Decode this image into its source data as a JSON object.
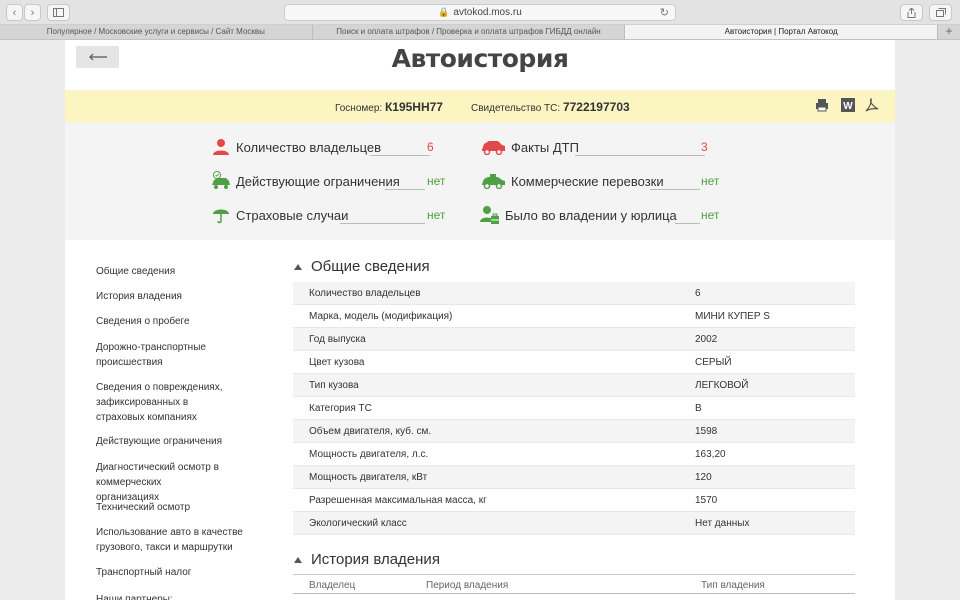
{
  "browser": {
    "url": "avtokod.mos.ru",
    "tabs": [
      "Популярное / Московские услуги и сервисы / Сайт Москвы",
      "Поиск и оплата штрафов / Проверка и оплата штрафов ГИБДД онлайн",
      "Автоистория | Портал Автокод"
    ],
    "active_tab": 2
  },
  "page": {
    "title": "Автоистория",
    "gosnomer_label": "Госномер:",
    "gosnomer": "К195НН77",
    "svid_label": "Свидетельство ТС:",
    "svid": "7722197703"
  },
  "summary": {
    "owners_label": "Количество владельцев",
    "owners_value": "6",
    "dtp_label": "Факты ДТП",
    "dtp_value": "3",
    "restrictions_label": "Действующие ограничения",
    "restrictions_value": "нет",
    "commercial_label": "Коммерческие перевозки",
    "commercial_value": "нет",
    "insurance_label": "Страховые случаи",
    "insurance_value": "нет",
    "legal_label": "Было во владении у юрлица",
    "legal_value": "нет"
  },
  "nav": [
    "Общие сведения",
    "История владения",
    "Сведения о пробеге",
    "Дорожно-транспортные происшествия",
    "Сведения о повреждениях, зафиксированных в страховых компаниях",
    "Действующие ограничения",
    "Диагностический осмотр в коммерческих организациях",
    "Технический осмотр",
    "Использование авто в качестве грузового, такси и маршрутки",
    "Транспортный налог",
    "Наши партнеры:"
  ],
  "general": {
    "heading": "Общие сведения",
    "rows": [
      {
        "k": "Количество владельцев",
        "v": "6"
      },
      {
        "k": "Марка, модель (модификация)",
        "v": "МИНИ КУПЕР S"
      },
      {
        "k": "Год выпуска",
        "v": "2002"
      },
      {
        "k": "Цвет кузова",
        "v": "СЕРЫЙ"
      },
      {
        "k": "Тип кузова",
        "v": "ЛЕГКОВОЙ"
      },
      {
        "k": "Категория ТС",
        "v": "B"
      },
      {
        "k": "Объем двигателя, куб. см.",
        "v": "1598"
      },
      {
        "k": "Мощность двигателя, л.с.",
        "v": "163,20"
      },
      {
        "k": "Мощность двигателя, кВт",
        "v": "120"
      },
      {
        "k": "Разрешенная максимальная масса, кг",
        "v": "1570"
      },
      {
        "k": "Экологический класс",
        "v": "Нет данных"
      }
    ]
  },
  "history": {
    "heading": "История владения",
    "col_owner": "Владелец",
    "col_period": "Период владения",
    "col_type": "Тип владения"
  },
  "colors": {
    "accent_red": "#e34848",
    "accent_green": "#4fa044",
    "plate_bg": "#fbf5c2"
  }
}
